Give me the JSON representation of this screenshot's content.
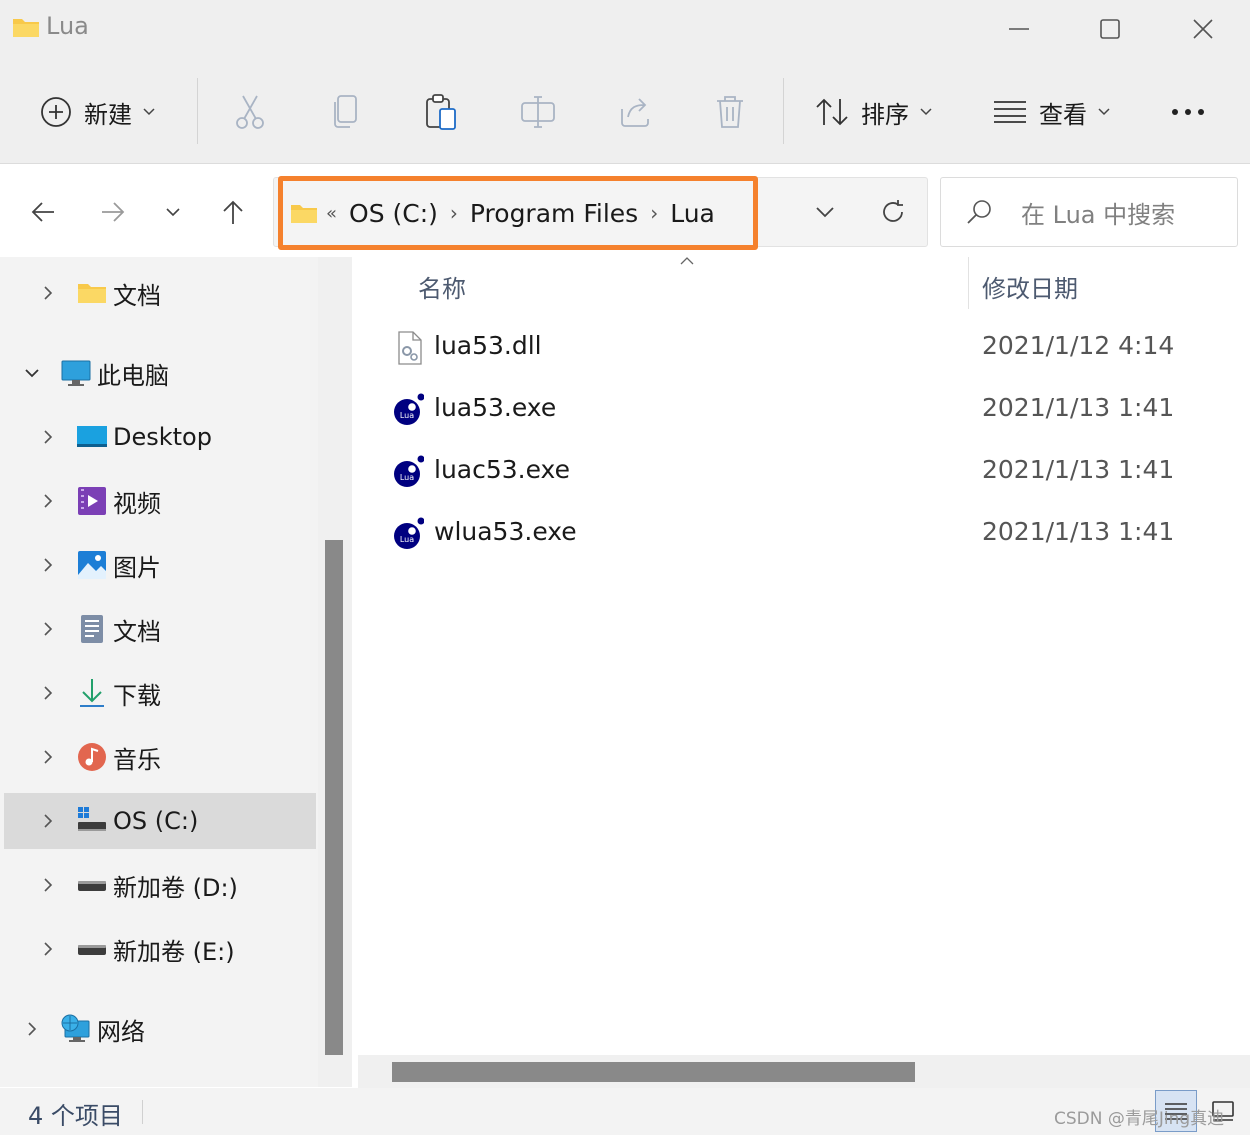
{
  "window": {
    "title": "Lua"
  },
  "toolbar": {
    "new_label": "新建",
    "sort_label": "排序",
    "view_label": "查看"
  },
  "address": {
    "crumb_lead": "«",
    "crumbs": [
      "OS (C:)",
      "Program Files",
      "Lua"
    ]
  },
  "search": {
    "placeholder": "在 Lua 中搜索"
  },
  "sidebar": {
    "items": [
      {
        "label": "文档",
        "icon": "folder-icon"
      },
      {
        "label": "此电脑",
        "icon": "computer-icon"
      },
      {
        "label": "Desktop",
        "icon": "desktop-icon"
      },
      {
        "label": "视频",
        "icon": "video-icon"
      },
      {
        "label": "图片",
        "icon": "pictures-icon"
      },
      {
        "label": "文档",
        "icon": "document-icon"
      },
      {
        "label": "下载",
        "icon": "download-icon"
      },
      {
        "label": "音乐",
        "icon": "music-icon"
      },
      {
        "label": "OS (C:)",
        "icon": "drive-c-icon"
      },
      {
        "label": "新加卷 (D:)",
        "icon": "drive-icon"
      },
      {
        "label": "新加卷 (E:)",
        "icon": "drive-icon"
      },
      {
        "label": "网络",
        "icon": "network-icon"
      }
    ]
  },
  "filelist": {
    "columns": {
      "name": "名称",
      "date": "修改日期"
    },
    "files": [
      {
        "name": "lua53.dll",
        "date": "2021/1/12 4:14",
        "icon": "dll-file-icon"
      },
      {
        "name": "lua53.exe",
        "date": "2021/1/13 1:41",
        "icon": "lua-app-icon"
      },
      {
        "name": "luac53.exe",
        "date": "2021/1/13 1:41",
        "icon": "lua-app-icon"
      },
      {
        "name": "wlua53.exe",
        "date": "2021/1/13 1:41",
        "icon": "lua-app-icon"
      }
    ]
  },
  "status": {
    "count": "4 个项目"
  },
  "watermark": "CSDN @青尾Jing真迪",
  "colors": {
    "highlight": "#f5812d",
    "lua_blue": "#000080"
  }
}
